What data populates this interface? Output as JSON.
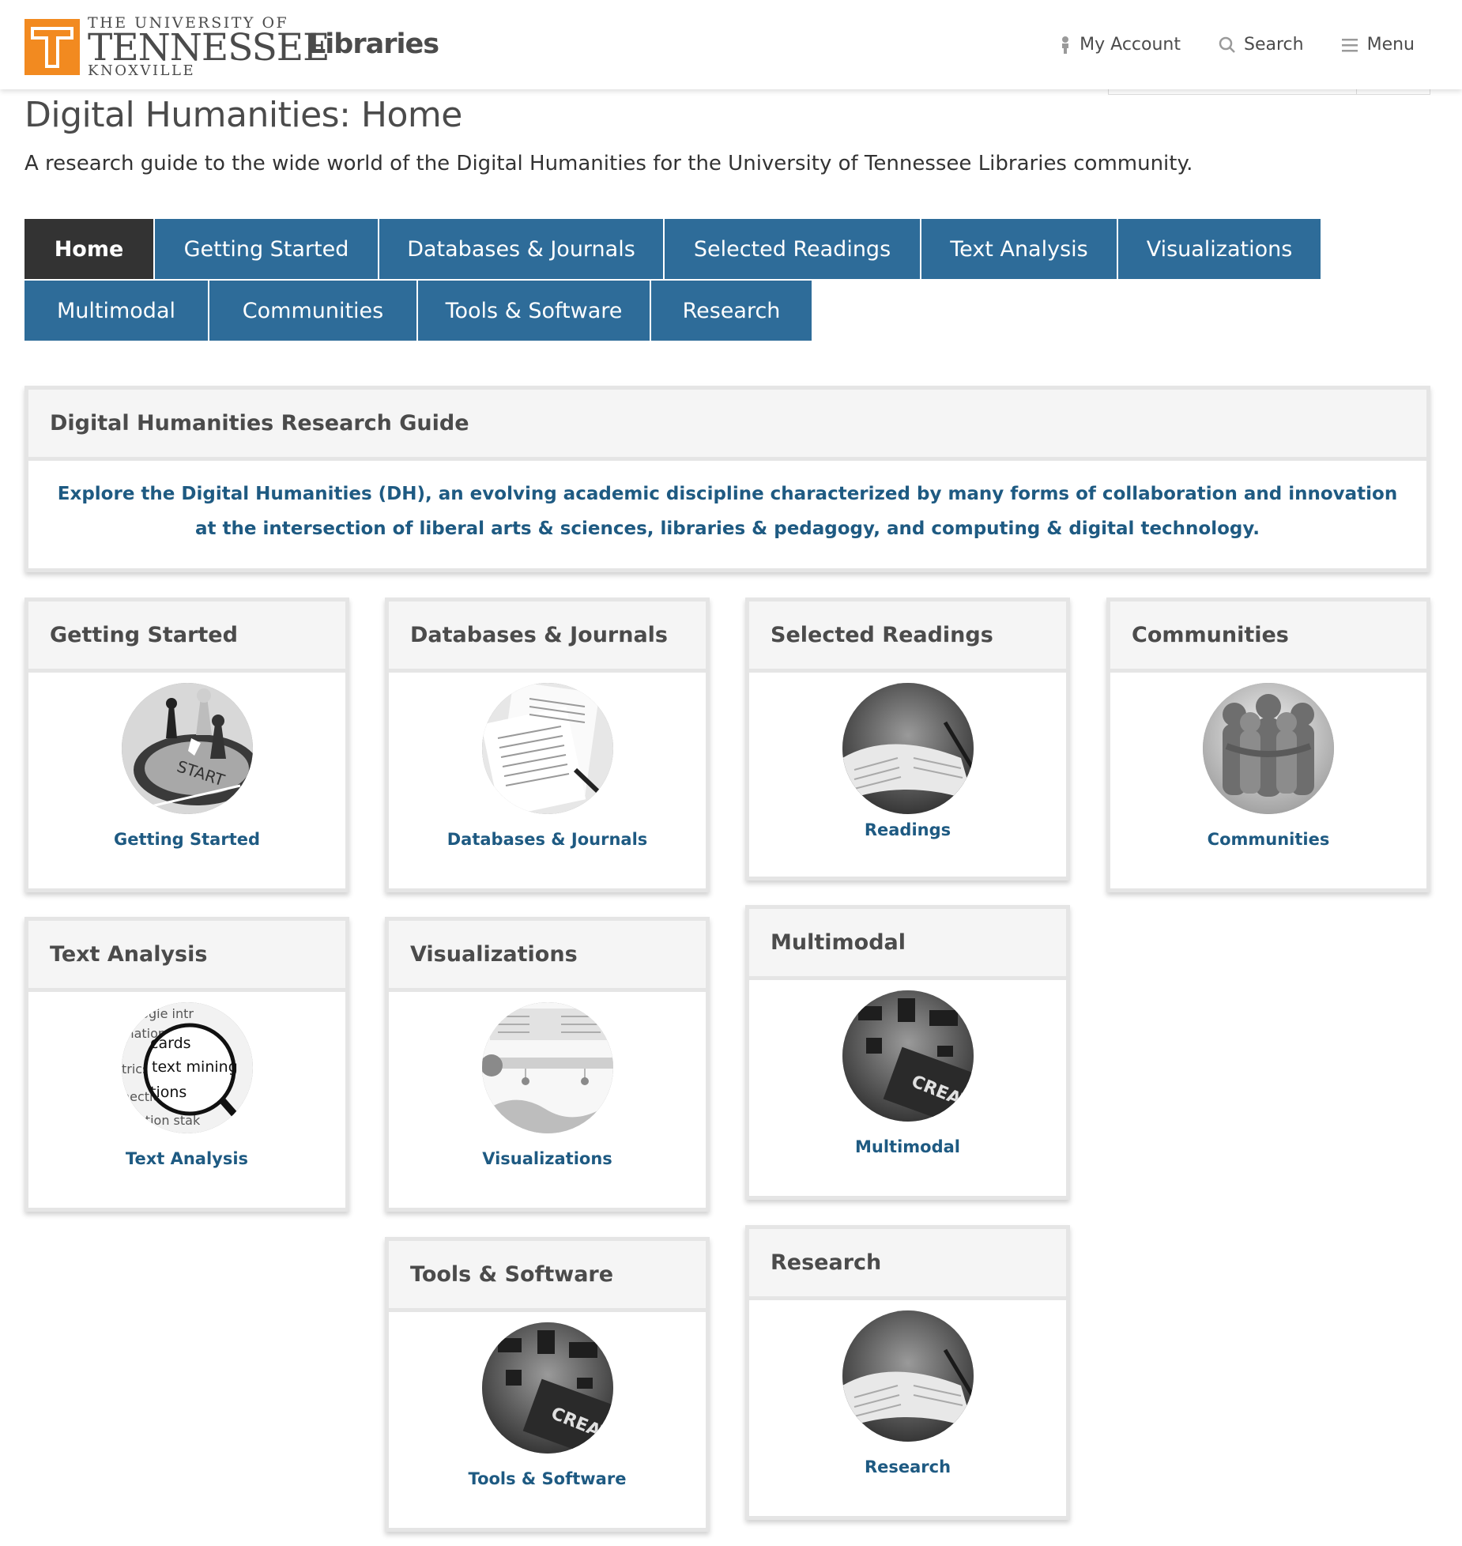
{
  "header": {
    "logo": {
      "line1": "THE UNIVERSITY OF",
      "line2": "TENNESSEE",
      "line3": "KNOXVILLE"
    },
    "libraries_label": "Libraries",
    "nav": {
      "account_label": "My Account",
      "search_label": "Search",
      "menu_label": "Menu"
    }
  },
  "page": {
    "title": "Digital Humanities: Home",
    "description": "A research guide to the wide world of the Digital Humanities for the University of Tennessee Libraries community."
  },
  "tabs": {
    "row1": [
      "Home",
      "Getting Started",
      "Databases & Journals",
      "Selected Readings",
      "Text Analysis",
      "Visualizations"
    ],
    "row2": [
      "Multimodal",
      "Communities",
      "Tools & Software",
      "Research"
    ]
  },
  "guide": {
    "title": "Digital Humanities Research Guide",
    "text": "Explore the Digital Humanities (DH), an evolving academic discipline characterized by many forms of collaboration and innovation at the intersection of liberal arts & sciences, libraries & pedagogy, and computing & digital technology."
  },
  "boxes": {
    "getting_started": {
      "title": "Getting Started",
      "link": "Getting Started",
      "icon": "board-game-start-image"
    },
    "databases": {
      "title": "Databases & Journals",
      "link": "Databases & Journals",
      "icon": "journal-pages-image"
    },
    "readings": {
      "title": "Selected Readings",
      "link": "Readings",
      "icon": "open-notebook-image"
    },
    "communities": {
      "title": "Communities",
      "link": "Communities",
      "icon": "clay-figures-huddle-image"
    },
    "text_analysis": {
      "title": "Text Analysis",
      "link": "Text Analysis",
      "icon": "magnifier-text-mining-image"
    },
    "visualizations": {
      "title": "Visualizations",
      "link": "Visualizations",
      "icon": "timeline-chart-image"
    },
    "multimodal": {
      "title": "Multimodal",
      "link": "Multimodal",
      "icon": "circuit-board-image"
    },
    "tools": {
      "title": "Tools & Software",
      "link": "Tools & Software",
      "icon": "circuit-board-image"
    },
    "research": {
      "title": "Research",
      "link": "Research",
      "icon": "open-notebook-image"
    }
  },
  "image_text": {
    "start": "START",
    "mining": "text mining",
    "chip": "CREATIV"
  },
  "colors": {
    "brand_orange": "#f28a20",
    "tab_blue": "#2e6c99",
    "tab_active": "#333333",
    "link_blue": "#1e5a82"
  }
}
